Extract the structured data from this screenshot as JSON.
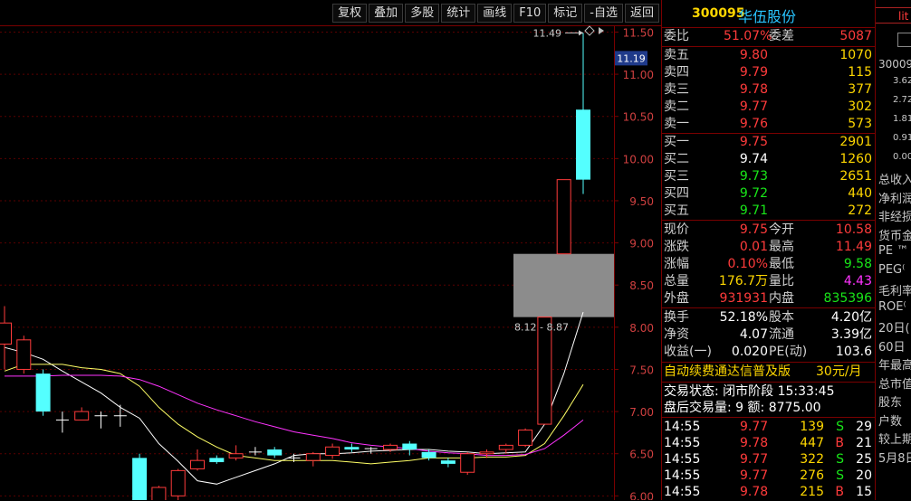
{
  "toolbar": {
    "buttons": [
      "复权",
      "叠加",
      "多股",
      "统计",
      "画线",
      "F10",
      "标记",
      "-自选",
      "返回"
    ]
  },
  "chart": {
    "current_price_tag": "11.19",
    "high_label": "11.49",
    "box_label": "8.12 - 8.87",
    "price_ticks": [
      "11.50",
      "11.00",
      "10.50",
      "10.00",
      "9.50",
      "9.00",
      "8.50",
      "8.00",
      "7.50",
      "7.00",
      "6.50",
      "6.00"
    ]
  },
  "chart_data": {
    "type": "candlestick",
    "title": "",
    "ylim": [
      5.95,
      11.58
    ],
    "y_ticks": [
      11.5,
      11.0,
      10.5,
      10.0,
      9.5,
      9.0,
      8.5,
      8.0,
      7.5,
      7.0,
      6.5,
      6.0
    ],
    "current_price": 11.19,
    "annotations": [
      {
        "text": "11.49",
        "price": 11.49
      },
      {
        "text": "8.12 - 8.87",
        "price": 8.12
      }
    ],
    "highlight_range": [
      8.12,
      8.87
    ],
    "candles": [
      {
        "o": 7.8,
        "c": 8.05,
        "h": 8.25,
        "l": 7.5
      },
      {
        "o": 7.5,
        "c": 7.85,
        "h": 7.9,
        "l": 7.45
      },
      {
        "o": 7.45,
        "c": 7.0,
        "h": 7.5,
        "l": 6.95
      },
      {
        "o": 6.9,
        "c": 6.9,
        "h": 7.0,
        "l": 6.75
      },
      {
        "o": 6.9,
        "c": 7.0,
        "h": 7.05,
        "l": 6.9
      },
      {
        "o": 6.95,
        "c": 6.95,
        "h": 7.0,
        "l": 6.8
      },
      {
        "o": 6.95,
        "c": 6.95,
        "h": 7.08,
        "l": 6.82
      },
      {
        "o": 6.45,
        "c": 5.8,
        "h": 6.5,
        "l": 5.8
      },
      {
        "o": 5.85,
        "c": 6.1,
        "h": 6.12,
        "l": 5.85
      },
      {
        "o": 6.0,
        "c": 6.3,
        "h": 6.32,
        "l": 5.9
      },
      {
        "o": 6.32,
        "c": 6.42,
        "h": 6.55,
        "l": 6.3
      },
      {
        "o": 6.45,
        "c": 6.4,
        "h": 6.48,
        "l": 6.38
      },
      {
        "o": 6.45,
        "c": 6.5,
        "h": 6.6,
        "l": 6.42
      },
      {
        "o": 6.52,
        "c": 6.52,
        "h": 6.58,
        "l": 6.48
      },
      {
        "o": 6.55,
        "c": 6.48,
        "h": 6.58,
        "l": 6.45
      },
      {
        "o": 6.45,
        "c": 6.45,
        "h": 6.5,
        "l": 6.4
      },
      {
        "o": 6.42,
        "c": 6.5,
        "h": 6.52,
        "l": 6.35
      },
      {
        "o": 6.48,
        "c": 6.58,
        "h": 6.62,
        "l": 6.44
      },
      {
        "o": 6.58,
        "c": 6.55,
        "h": 6.62,
        "l": 6.52
      },
      {
        "o": 6.56,
        "c": 6.56,
        "h": 6.58,
        "l": 6.5
      },
      {
        "o": 6.55,
        "c": 6.6,
        "h": 6.62,
        "l": 6.52
      },
      {
        "o": 6.62,
        "c": 6.55,
        "h": 6.65,
        "l": 6.48
      },
      {
        "o": 6.52,
        "c": 6.45,
        "h": 6.55,
        "l": 6.42
      },
      {
        "o": 6.42,
        "c": 6.38,
        "h": 6.45,
        "l": 6.34
      },
      {
        "o": 6.28,
        "c": 6.5,
        "h": 6.52,
        "l": 6.25
      },
      {
        "o": 6.5,
        "c": 6.52,
        "h": 6.55,
        "l": 6.45
      },
      {
        "o": 6.55,
        "c": 6.6,
        "h": 6.62,
        "l": 6.5
      },
      {
        "o": 6.6,
        "c": 6.78,
        "h": 6.8,
        "l": 6.58
      },
      {
        "o": 6.85,
        "c": 8.12,
        "h": 8.12,
        "l": 6.85
      },
      {
        "o": 8.87,
        "c": 9.75,
        "h": 9.75,
        "l": 8.87
      },
      {
        "o": 10.58,
        "c": 9.75,
        "h": 11.49,
        "l": 9.58
      }
    ],
    "ma_series": [
      {
        "color": "#ffffff",
        "values": [
          7.76,
          7.7,
          7.62,
          7.48,
          7.35,
          7.22,
          7.05,
          6.92,
          6.62,
          6.41,
          6.18,
          6.14,
          6.22,
          6.3,
          6.38,
          6.48,
          6.5,
          6.5,
          6.51,
          6.53,
          6.54,
          6.55,
          6.55,
          6.53,
          6.52,
          6.5,
          6.51,
          6.52,
          6.85,
          7.45,
          8.18
        ]
      },
      {
        "color": "#ffff66",
        "values": [
          7.48,
          7.56,
          7.56,
          7.56,
          7.52,
          7.5,
          7.45,
          7.3,
          7.05,
          6.85,
          6.7,
          6.58,
          6.48,
          6.45,
          6.42,
          6.42,
          6.42,
          6.42,
          6.4,
          6.38,
          6.4,
          6.42,
          6.45,
          6.45,
          6.45,
          6.46,
          6.46,
          6.48,
          6.62,
          6.95,
          7.32
        ]
      },
      {
        "color": "#ff33ff",
        "values": [
          7.42,
          7.42,
          7.42,
          7.43,
          7.43,
          7.43,
          7.42,
          7.38,
          7.3,
          7.2,
          7.1,
          7.02,
          6.95,
          6.88,
          6.82,
          6.76,
          6.72,
          6.68,
          6.63,
          6.6,
          6.58,
          6.56,
          6.53,
          6.51,
          6.5,
          6.48,
          6.48,
          6.49,
          6.56,
          6.72,
          6.9
        ]
      }
    ]
  },
  "quote": {
    "code": "300095",
    "name": "华伍股份",
    "weibi": {
      "label1": "委比",
      "v1": "51.07%",
      "label2": "委差",
      "v2": "5087"
    },
    "sells": [
      {
        "label": "卖五",
        "price": "9.80",
        "vol": "1070"
      },
      {
        "label": "卖四",
        "price": "9.79",
        "vol": "115"
      },
      {
        "label": "卖三",
        "price": "9.78",
        "vol": "377"
      },
      {
        "label": "卖二",
        "price": "9.77",
        "vol": "302"
      },
      {
        "label": "卖一",
        "price": "9.76",
        "vol": "573"
      }
    ],
    "buys": [
      {
        "label": "买一",
        "price": "9.75",
        "vol": "2901",
        "color": "r"
      },
      {
        "label": "买二",
        "price": "9.74",
        "vol": "1260",
        "color": "w"
      },
      {
        "label": "买三",
        "price": "9.73",
        "vol": "2651",
        "color": "g"
      },
      {
        "label": "买四",
        "price": "9.72",
        "vol": "440",
        "color": "g"
      },
      {
        "label": "买五",
        "price": "9.71",
        "vol": "272",
        "color": "g"
      }
    ],
    "stats": [
      {
        "l1": "现价",
        "v1": "9.75",
        "c1": "r",
        "l2": "今开",
        "v2": "10.58",
        "c2": "r"
      },
      {
        "l1": "涨跌",
        "v1": "0.01",
        "c1": "r",
        "l2": "最高",
        "v2": "11.49",
        "c2": "r"
      },
      {
        "l1": "涨幅",
        "v1": "0.10%",
        "c1": "r",
        "l2": "最低",
        "v2": "9.58",
        "c2": "g"
      },
      {
        "l1": "总量",
        "v1": "176.7万",
        "c1": "y",
        "l2": "量比",
        "v2": "4.43",
        "c2": "m"
      },
      {
        "l1": "外盘",
        "v1": "931931",
        "c1": "r",
        "l2": "内盘",
        "v2": "835396",
        "c2": "g"
      }
    ],
    "stats2": [
      {
        "l1": "换手",
        "v1": "52.18%",
        "l2": "股本",
        "v2": "4.20亿"
      },
      {
        "l1": "净资",
        "v1": "4.07",
        "l2": "流通",
        "v2": "3.39亿"
      },
      {
        "l1": "收益(一)",
        "v1": "0.020",
        "l2": "PE(动)",
        "v2": "103.6"
      }
    ],
    "ad": {
      "text": "自动续费通达信普及版",
      "price": "30元/月"
    },
    "trade_status": "交易状态: 闭市阶段 15:33:45",
    "after_hours": "盘后交易量: 9  额: 8775.00",
    "ticks": [
      {
        "time": "14:55",
        "price": "9.77",
        "vol": "139",
        "side": "S",
        "n": "29"
      },
      {
        "time": "14:55",
        "price": "9.78",
        "vol": "447",
        "side": "B",
        "n": "21"
      },
      {
        "time": "14:55",
        "price": "9.77",
        "vol": "322",
        "side": "S",
        "n": "25"
      },
      {
        "time": "14:55",
        "price": "9.77",
        "vol": "276",
        "side": "S",
        "n": "20"
      },
      {
        "time": "14:55",
        "price": "9.78",
        "vol": "215",
        "side": "B",
        "n": "15"
      }
    ]
  },
  "right_panel": {
    "tab": "lit",
    "code": "30009",
    "nums": [
      "3.62",
      "2.72",
      "1.81",
      "0.91",
      "0.00"
    ],
    "labels": [
      "总收入",
      "净利润",
      "非经损",
      "货币金",
      "PE ™",
      "PEG⁽",
      "毛利率",
      "ROE⁽",
      "20日(",
      "60日",
      "年最高",
      "总市值",
      "股东",
      "户数",
      "较上期",
      "5月8日"
    ]
  }
}
